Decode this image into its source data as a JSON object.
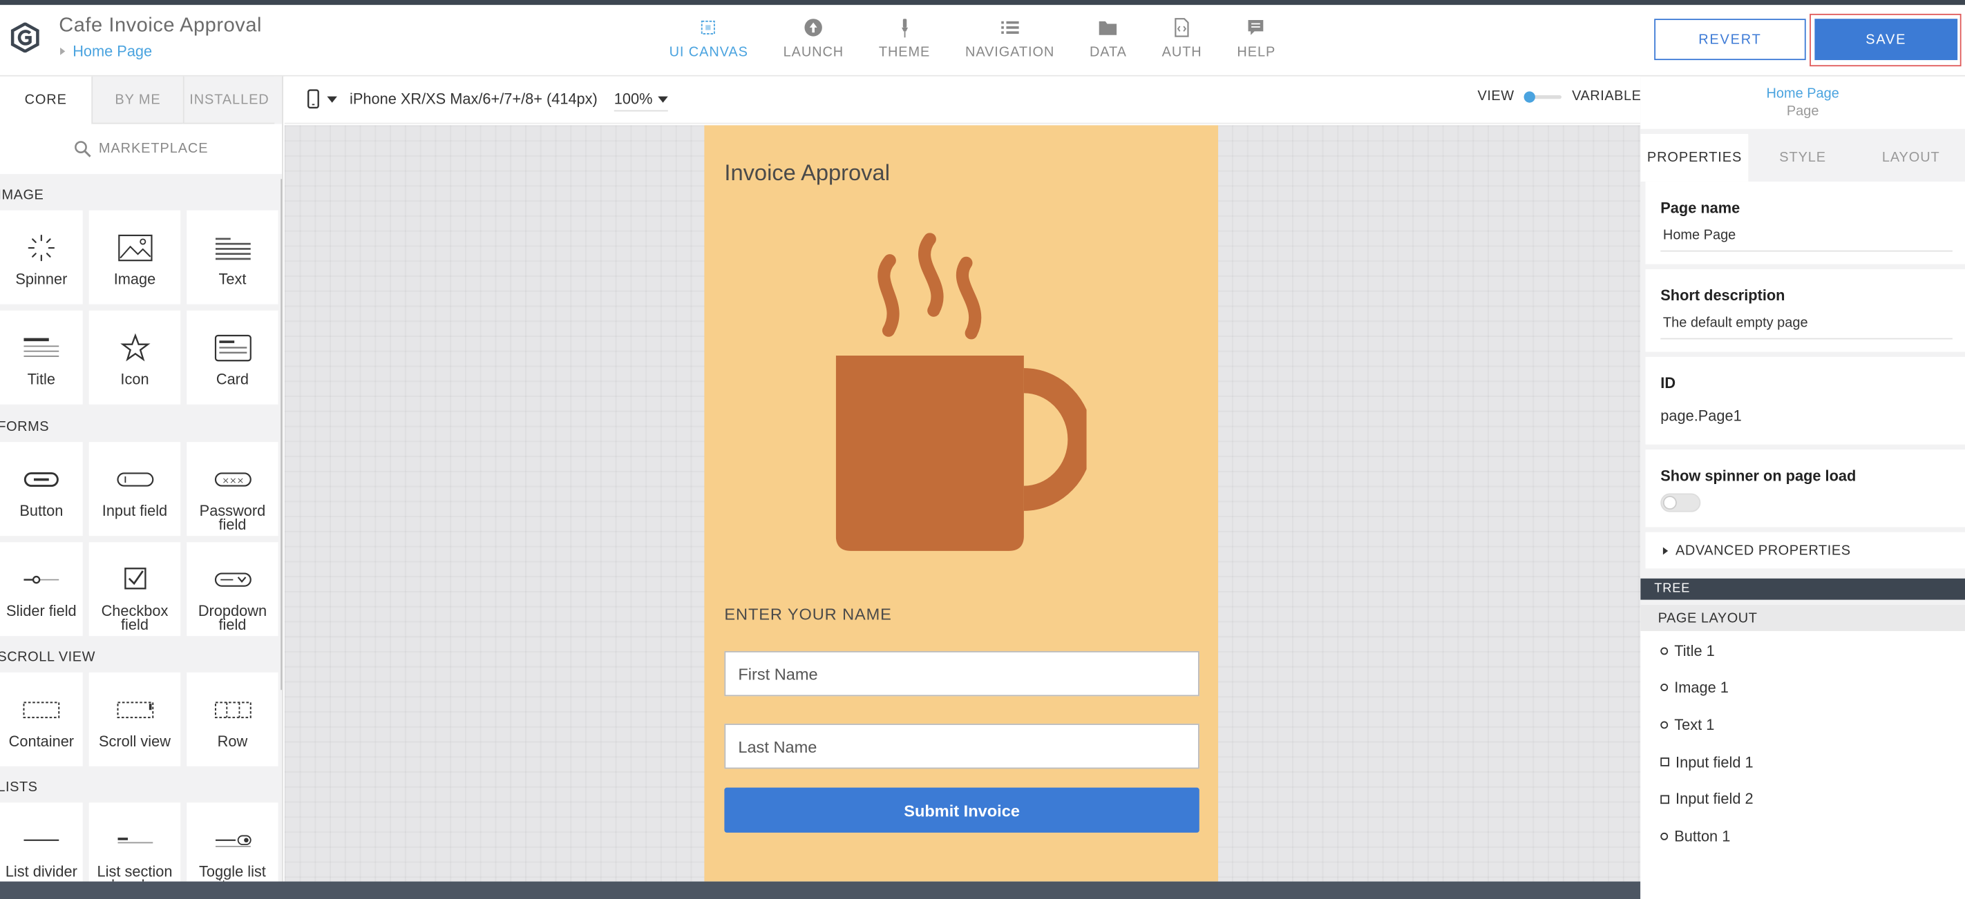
{
  "header": {
    "app_title": "Cafe Invoice Approval",
    "breadcrumb": "Home Page",
    "nav": [
      {
        "label": "UI CANVAS",
        "icon": "ui-canvas-icon",
        "active": true
      },
      {
        "label": "LAUNCH",
        "icon": "launch-icon"
      },
      {
        "label": "THEME",
        "icon": "theme-icon"
      },
      {
        "label": "NAVIGATION",
        "icon": "navigation-icon"
      },
      {
        "label": "DATA",
        "icon": "data-icon"
      },
      {
        "label": "AUTH",
        "icon": "auth-icon"
      },
      {
        "label": "HELP",
        "icon": "help-icon"
      }
    ],
    "revert_label": "REVERT",
    "save_label": "SAVE"
  },
  "palette": {
    "tabs": [
      "CORE",
      "BY ME",
      "INSTALLED"
    ],
    "marketplace_label": "MARKETPLACE",
    "sections": [
      {
        "title": "IMAGE",
        "items": [
          {
            "label": "Spinner",
            "icon": "spinner-icon"
          },
          {
            "label": "Image",
            "icon": "image-icon"
          },
          {
            "label": "Text",
            "icon": "text-icon"
          },
          {
            "label": "Title",
            "icon": "title-icon"
          },
          {
            "label": "Icon",
            "icon": "star-icon"
          },
          {
            "label": "Card",
            "icon": "card-icon"
          }
        ]
      },
      {
        "title": "FORMS",
        "items": [
          {
            "label": "Button",
            "icon": "button-icon"
          },
          {
            "label": "Input field",
            "icon": "input-field-icon"
          },
          {
            "label": "Password field",
            "icon": "password-field-icon"
          },
          {
            "label": "Slider field",
            "icon": "slider-field-icon"
          },
          {
            "label": "Checkbox field",
            "icon": "checkbox-field-icon"
          },
          {
            "label": "Dropdown field",
            "icon": "dropdown-field-icon"
          }
        ]
      },
      {
        "title": "SCROLL VIEW",
        "items": [
          {
            "label": "Container",
            "icon": "container-icon"
          },
          {
            "label": "Scroll view",
            "icon": "scroll-view-icon"
          },
          {
            "label": "Row",
            "icon": "row-icon"
          }
        ]
      },
      {
        "title": "LISTS",
        "items": [
          {
            "label": "List divider",
            "icon": "list-divider-icon"
          },
          {
            "label": "List section header",
            "icon": "list-section-header-icon"
          },
          {
            "label": "Toggle list item",
            "icon": "toggle-list-item-icon"
          }
        ]
      }
    ]
  },
  "toolbar": {
    "device": "iPhone XR/XS Max/6+/7+/8+ (414px)",
    "zoom": "100%",
    "view_label": "VIEW",
    "variables_label": "VARIABLES"
  },
  "phone": {
    "title": "Invoice Approval",
    "image": "coffee-mug-icon",
    "name_label": "ENTER YOUR NAME",
    "first_name_placeholder": "First Name",
    "last_name_placeholder": "Last Name",
    "submit_label": "Submit Invoice",
    "background_color": "#f8cf8b",
    "mug_color": "#c26d39",
    "button_color": "#3c7bd5"
  },
  "properties": {
    "page_title": "Home Page",
    "page_type": "Page",
    "tabs": [
      "PROPERTIES",
      "STYLE",
      "LAYOUT"
    ],
    "page_name_label": "Page name",
    "page_name_value": "Home Page",
    "short_desc_label": "Short description",
    "short_desc_value": "The default empty page",
    "id_label": "ID",
    "id_value": "page.Page1",
    "spinner_label": "Show spinner on page load",
    "spinner_on": false,
    "advanced_label": "ADVANCED PROPERTIES"
  },
  "tree": {
    "bar_label": "TREE",
    "header": "PAGE LAYOUT",
    "items": [
      {
        "label": "Title 1",
        "marker": "circle"
      },
      {
        "label": "Image 1",
        "marker": "circle"
      },
      {
        "label": "Text 1",
        "marker": "circle"
      },
      {
        "label": "Input field 1",
        "marker": "square"
      },
      {
        "label": "Input field 2",
        "marker": "square"
      },
      {
        "label": "Button 1",
        "marker": "circle"
      }
    ]
  }
}
